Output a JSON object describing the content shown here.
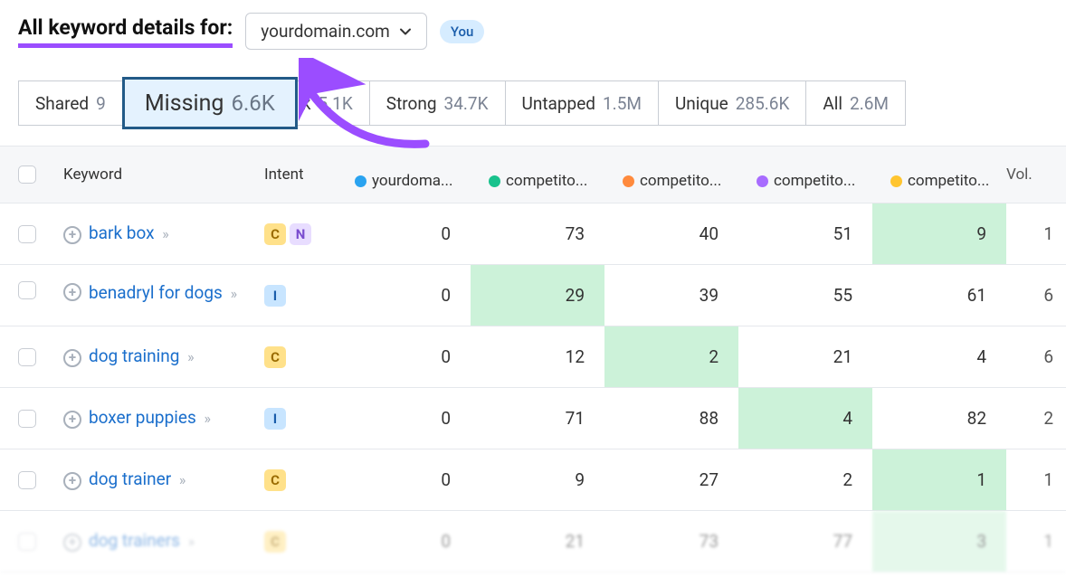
{
  "header": {
    "title": "All keyword details for:",
    "domain": "yourdomain.com",
    "you_badge": "You"
  },
  "filters": {
    "shared": {
      "label": "Shared",
      "count": "9"
    },
    "missing": {
      "label": "Missing",
      "count": "6.6K"
    },
    "weak": {
      "label": "k",
      "count": "5.1K"
    },
    "strong": {
      "label": "Strong",
      "count": "34.7K"
    },
    "untapped": {
      "label": "Untapped",
      "count": "1.5M"
    },
    "unique": {
      "label": "Unique",
      "count": "285.6K"
    },
    "all": {
      "label": "All",
      "count": "2.6M"
    }
  },
  "columns": {
    "keyword": "Keyword",
    "intent": "Intent",
    "c0": "yourdoma...",
    "c1": "competito...",
    "c2": "competito...",
    "c3": "competito...",
    "c4": "competito...",
    "vol": "Vol."
  },
  "rows": [
    {
      "keyword": "bark box",
      "intents": [
        "C",
        "N"
      ],
      "vals": [
        "0",
        "73",
        "40",
        "51",
        "9"
      ],
      "highlight": 4,
      "vol": "1"
    },
    {
      "keyword": "benadryl for dogs",
      "intents": [
        "I"
      ],
      "vals": [
        "0",
        "29",
        "39",
        "55",
        "61"
      ],
      "highlight": 1,
      "vol": "6"
    },
    {
      "keyword": "dog training",
      "intents": [
        "C"
      ],
      "vals": [
        "0",
        "12",
        "2",
        "21",
        "4"
      ],
      "highlight": 2,
      "vol": "6"
    },
    {
      "keyword": "boxer puppies",
      "intents": [
        "I"
      ],
      "vals": [
        "0",
        "71",
        "88",
        "4",
        "82"
      ],
      "highlight": 3,
      "vol": "2"
    },
    {
      "keyword": "dog trainer",
      "intents": [
        "C"
      ],
      "vals": [
        "0",
        "9",
        "27",
        "2",
        "1"
      ],
      "highlight": 4,
      "vol": "1"
    },
    {
      "keyword": "dog trainers",
      "intents": [
        "C"
      ],
      "vals": [
        "0",
        "21",
        "73",
        "77",
        "3"
      ],
      "highlight": 4,
      "vol": "1"
    }
  ]
}
